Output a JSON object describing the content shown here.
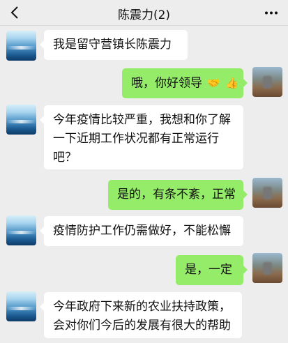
{
  "header": {
    "title": "陈震力(2)",
    "back_icon": "back-chevron-icon",
    "more_icon": "more-dots-icon"
  },
  "messages": [
    {
      "side": "left",
      "text": "我是留守营镇长陈震力"
    },
    {
      "side": "right",
      "text": "哦，你好领导",
      "emoji": [
        "handshake-emoji",
        "thumbs-up-emoji"
      ]
    },
    {
      "side": "left",
      "lines": [
        "今年疫情比较严重，我想和你了解",
        "一下近期工作状况都有正常运行",
        "吧？"
      ]
    },
    {
      "side": "right",
      "text": "是的，有条不紊，正常"
    },
    {
      "side": "left",
      "text": "疫情防护工作仍需做好，不能松懈"
    },
    {
      "side": "right",
      "text": "是，一定"
    },
    {
      "side": "left",
      "lines": [
        "今年政府下来新的农业扶持政策，",
        "会对你们今后的发展有很大的帮助"
      ]
    }
  ],
  "colors": {
    "background": "#ededed",
    "left_bubble": "#ffffff",
    "right_bubble": "#95ec69"
  }
}
